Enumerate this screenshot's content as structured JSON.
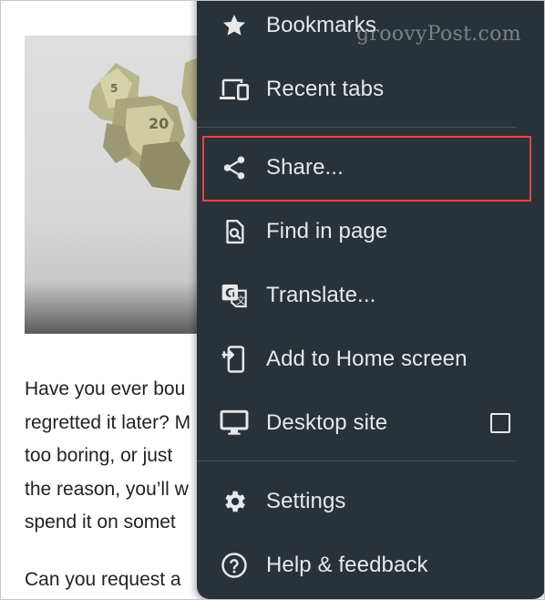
{
  "watermark": "groovyPost.com",
  "article": {
    "paragraph1": [
      "Have you ever bou",
      "regretted it later? M",
      "too boring, or just",
      "the reason, you’ll w",
      "spend it on somet"
    ],
    "paragraph2": [
      "Can you request a"
    ]
  },
  "menu": {
    "items": [
      {
        "label": "Bookmarks",
        "icon": "star-icon"
      },
      {
        "label": "Recent tabs",
        "icon": "devices-icon"
      },
      {
        "label": "Share...",
        "icon": "share-icon",
        "highlighted": true
      },
      {
        "label": "Find in page",
        "icon": "find-in-page-icon"
      },
      {
        "label": "Translate...",
        "icon": "translate-icon"
      },
      {
        "label": "Add to Home screen",
        "icon": "add-to-home-icon"
      },
      {
        "label": "Desktop site",
        "icon": "desktop-icon",
        "checked": false
      },
      {
        "label": "Settings",
        "icon": "gear-icon"
      },
      {
        "label": "Help & feedback",
        "icon": "help-icon"
      }
    ]
  },
  "colors": {
    "menu_background": "#293238",
    "menu_text": "#e6e8ea",
    "highlight_border": "#d84a4a"
  }
}
